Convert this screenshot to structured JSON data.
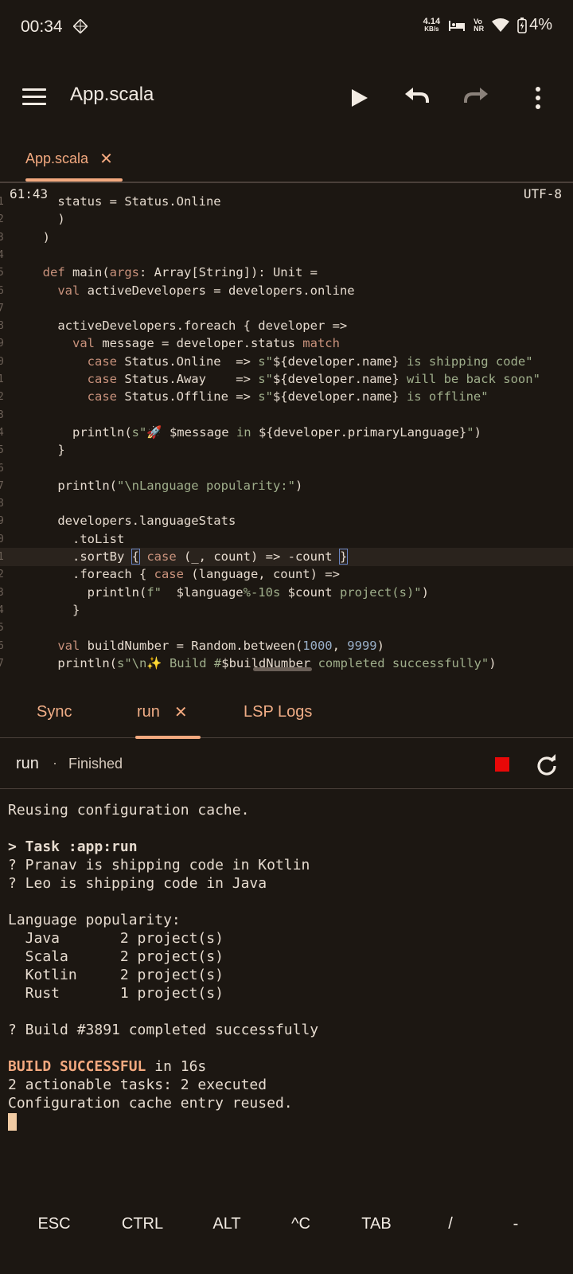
{
  "status_bar": {
    "time": "00:34",
    "net_speed_value": "4.14",
    "net_speed_unit": "KB/s",
    "network_line1": "Vo",
    "network_line2": "NR",
    "battery": "4%"
  },
  "toolbar": {
    "title": "App.scala",
    "icons": [
      "menu-icon",
      "play-icon",
      "undo-icon",
      "redo-icon",
      "more-vert-icon"
    ]
  },
  "file_tabs": [
    {
      "label": "App.scala",
      "active": true
    }
  ],
  "editor": {
    "cursor_position": "61:43",
    "encoding": "UTF-8",
    "lines": [
      {
        "num": "1",
        "segs": [
          [
            "    status = Status.Online",
            ""
          ]
        ]
      },
      {
        "num": "2",
        "segs": [
          [
            "    )",
            ""
          ]
        ]
      },
      {
        "num": "3",
        "segs": [
          [
            "  )",
            ""
          ]
        ]
      },
      {
        "num": "4",
        "segs": [
          [
            "",
            ""
          ]
        ]
      },
      {
        "num": "5",
        "segs": [
          [
            "  ",
            ""
          ],
          [
            "def",
            "kw"
          ],
          [
            " main(",
            ""
          ],
          [
            "args",
            "kw"
          ],
          [
            ": Array[String]): Unit =",
            ""
          ]
        ]
      },
      {
        "num": "6",
        "segs": [
          [
            "    ",
            ""
          ],
          [
            "val",
            "kw"
          ],
          [
            " activeDevelopers = developers.online",
            ""
          ]
        ]
      },
      {
        "num": "7",
        "segs": [
          [
            "",
            ""
          ]
        ]
      },
      {
        "num": "8",
        "segs": [
          [
            "    activeDevelopers.foreach { developer =>",
            ""
          ]
        ]
      },
      {
        "num": "9",
        "segs": [
          [
            "      ",
            ""
          ],
          [
            "val",
            "kw"
          ],
          [
            " message = developer.status ",
            ""
          ],
          [
            "match",
            "kw"
          ]
        ]
      },
      {
        "num": "0",
        "segs": [
          [
            "        ",
            ""
          ],
          [
            "case",
            "kw"
          ],
          [
            " Status.Online  => ",
            ""
          ],
          [
            "s\"",
            "str"
          ],
          [
            "${developer.name}",
            ""
          ],
          [
            " is shipping code\"",
            "str"
          ]
        ]
      },
      {
        "num": "1",
        "segs": [
          [
            "        ",
            ""
          ],
          [
            "case",
            "kw"
          ],
          [
            " Status.Away    => ",
            ""
          ],
          [
            "s\"",
            "str"
          ],
          [
            "${developer.name}",
            ""
          ],
          [
            " will be back soon\"",
            "str"
          ]
        ]
      },
      {
        "num": "2",
        "segs": [
          [
            "        ",
            ""
          ],
          [
            "case",
            "kw"
          ],
          [
            " Status.Offline => ",
            ""
          ],
          [
            "s\"",
            "str"
          ],
          [
            "${developer.name}",
            ""
          ],
          [
            " is offline\"",
            "str"
          ]
        ]
      },
      {
        "num": "3",
        "segs": [
          [
            "",
            ""
          ]
        ]
      },
      {
        "num": "4",
        "segs": [
          [
            "      println(",
            ""
          ],
          [
            "s\"🚀 ",
            "str"
          ],
          [
            "$message",
            ""
          ],
          [
            " in ",
            "str"
          ],
          [
            "${developer.primaryLanguage}",
            ""
          ],
          [
            "\"",
            "str"
          ],
          [
            ")",
            ""
          ]
        ]
      },
      {
        "num": "5",
        "segs": [
          [
            "    }",
            ""
          ]
        ]
      },
      {
        "num": "6",
        "segs": [
          [
            "",
            ""
          ]
        ]
      },
      {
        "num": "7",
        "segs": [
          [
            "    println(",
            ""
          ],
          [
            "\"\\nLanguage popularity:\"",
            "str"
          ],
          [
            ")",
            ""
          ]
        ]
      },
      {
        "num": "8",
        "segs": [
          [
            "",
            ""
          ]
        ]
      },
      {
        "num": "9",
        "segs": [
          [
            "    developers.languageStats",
            ""
          ]
        ]
      },
      {
        "num": "0",
        "segs": [
          [
            "      .toList",
            ""
          ]
        ]
      },
      {
        "num": "1",
        "current": true,
        "segs": [
          [
            "      .sortBy ",
            ""
          ],
          [
            "{",
            "brk"
          ],
          [
            " ",
            ""
          ],
          [
            "case",
            "kw"
          ],
          [
            " (_, count) => -count ",
            ""
          ],
          [
            "}",
            "brk"
          ]
        ]
      },
      {
        "num": "2",
        "segs": [
          [
            "      .foreach { ",
            ""
          ],
          [
            "case",
            "kw"
          ],
          [
            " (language, count) =>",
            ""
          ]
        ]
      },
      {
        "num": "3",
        "segs": [
          [
            "        println(",
            ""
          ],
          [
            "f\"  ",
            "str"
          ],
          [
            "$language",
            ""
          ],
          [
            "%-10s ",
            "str"
          ],
          [
            "$count",
            ""
          ],
          [
            " project(s)\"",
            "str"
          ],
          [
            ")",
            ""
          ]
        ]
      },
      {
        "num": "4",
        "segs": [
          [
            "      }",
            ""
          ]
        ]
      },
      {
        "num": "5",
        "segs": [
          [
            "",
            ""
          ]
        ]
      },
      {
        "num": "6",
        "segs": [
          [
            "    ",
            ""
          ],
          [
            "val",
            "kw"
          ],
          [
            " buildNumber = Random.between(",
            ""
          ],
          [
            "1000",
            "num-lit"
          ],
          [
            ", ",
            ""
          ],
          [
            "9999",
            "num-lit"
          ],
          [
            ")",
            ""
          ]
        ]
      },
      {
        "num": "7",
        "segs": [
          [
            "    println(",
            ""
          ],
          [
            "s\"\\n✨ Build #",
            "str"
          ],
          [
            "$buildNumber",
            ""
          ],
          [
            " completed successfully\"",
            "str"
          ],
          [
            ")",
            ""
          ]
        ]
      }
    ]
  },
  "panel_tabs": [
    {
      "label": "Sync"
    },
    {
      "label": "run",
      "active": true,
      "closable": true
    },
    {
      "label": "LSP Logs"
    }
  ],
  "run_header": {
    "name": "run",
    "separator": "·",
    "status": "Finished"
  },
  "terminal": {
    "lines": [
      "Reusing configuration cache.",
      "",
      "> Task :app:run",
      "? Pranav is shipping code in Kotlin",
      "? Leo is shipping code in Java",
      "",
      "Language popularity:",
      "  Java       2 project(s)",
      "  Scala      2 project(s)",
      "  Kotlin     2 project(s)",
      "  Rust       1 project(s)",
      "",
      "? Build #3891 completed successfully",
      ""
    ],
    "build_bold": "BUILD SUCCESSFUL",
    "build_rest": " in 16s",
    "after_lines": [
      "2 actionable tasks: 2 executed",
      "Configuration cache entry reused."
    ]
  },
  "extra_keys": [
    "ESC",
    "CTRL",
    "ALT",
    "^C",
    "TAB",
    "/",
    "-"
  ],
  "colors": {
    "background": "#1c1712",
    "accent": "#f3a97f",
    "stop": "#e80808"
  }
}
